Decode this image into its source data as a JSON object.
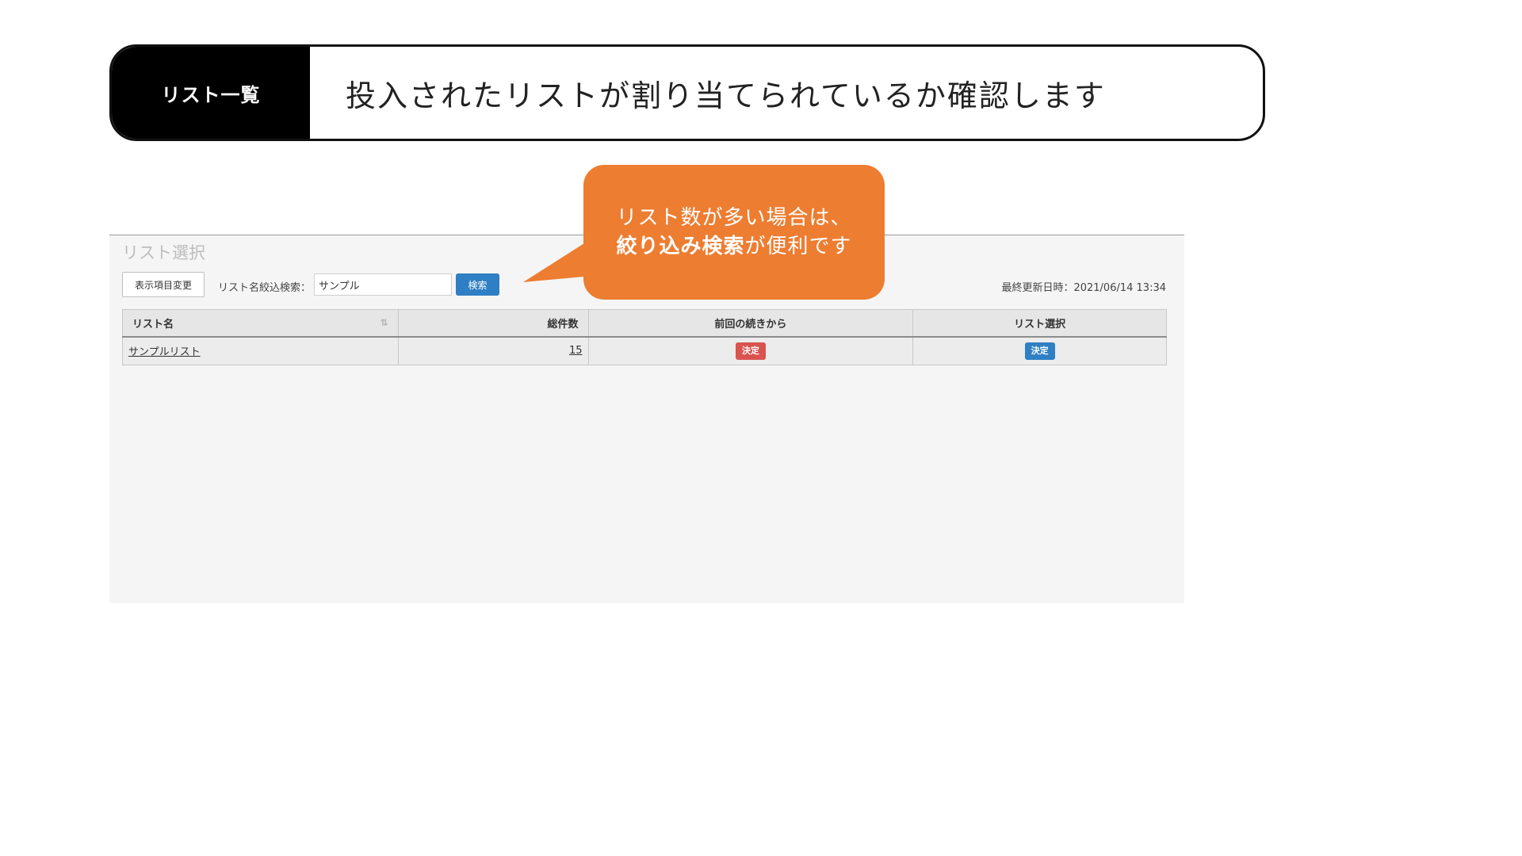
{
  "banner": {
    "tag": "リスト一覧",
    "text": "投入されたリストが割り当てられているか確認します"
  },
  "panel": {
    "title": "リスト選択",
    "display_button": "表示項目変更",
    "filter_label": "リスト名絞込検索：",
    "filter_value": "サンプル",
    "search_button": "検索",
    "updated": "最終更新日時：2021/06/14 13:34"
  },
  "table": {
    "headers": {
      "name": "リスト名",
      "total": "総件数",
      "continue": "前回の続きから",
      "select": "リスト選択"
    },
    "rows": [
      {
        "name": "サンプルリスト",
        "total": "15",
        "continue_button": "決定",
        "select_button": "決定"
      }
    ]
  },
  "callout": {
    "line1": "リスト数が多い場合は、",
    "line2_bold": "絞り込み検索",
    "line2_rest": "が便利です"
  },
  "colors": {
    "callout": "#ed7d31",
    "primary_button": "#2f7fc4",
    "danger_button": "#d9534f",
    "banner_tag_bg": "#000000"
  },
  "icons": {
    "sort": "sort-arrows-icon"
  }
}
